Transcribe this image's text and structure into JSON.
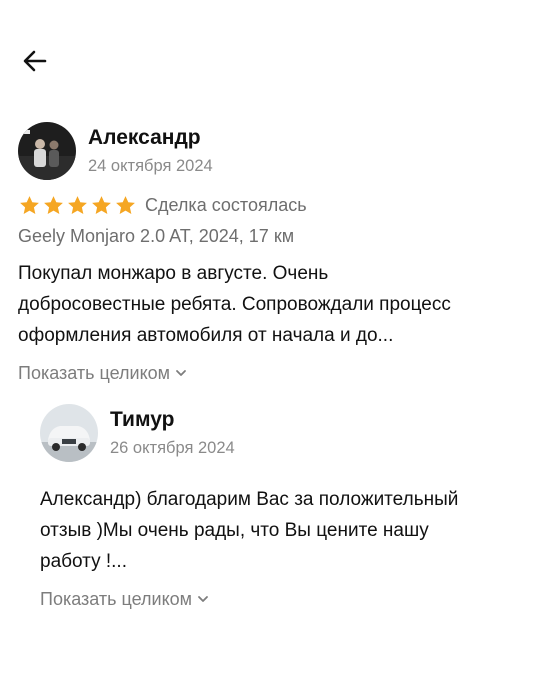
{
  "header": {
    "back_icon": "arrow-left-icon"
  },
  "review": {
    "author": "Александр",
    "date": "24 октября 2024",
    "rating": 5,
    "rating_max": 5,
    "star_color": "#f5a623",
    "deal_status": "Сделка состоялась",
    "car": "Geely Monjaro 2.0 AT, 2024, 17 км",
    "text_lines": [
      "Покупал монжаро в августе. Очень",
      "добросовестные ребята. Сопровождали процесс",
      "оформления автомобиля от начала и до..."
    ],
    "expand_label": "Показать целиком"
  },
  "reply": {
    "author": "Тимур",
    "date": "26 октября 2024",
    "text_lines": [
      "Александр) благодарим Вас за положительный",
      "отзыв )Мы очень рады, что Вы цените нашу",
      "работу !..."
    ],
    "expand_label": "Показать целиком"
  }
}
